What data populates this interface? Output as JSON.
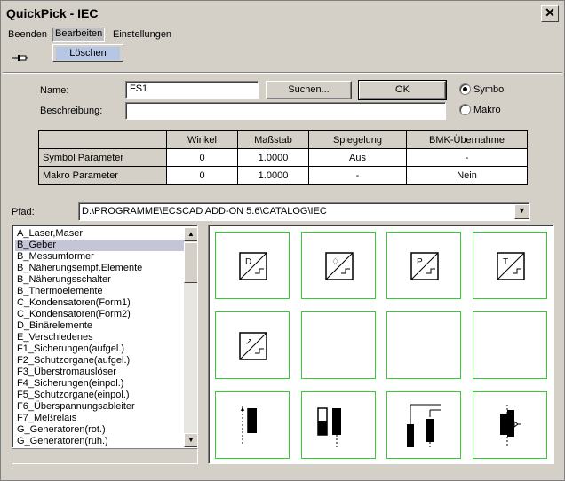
{
  "window": {
    "title": "QuickPick - IEC",
    "close_glyph": "✕"
  },
  "menu": {
    "items": [
      "Beenden",
      "Bearbeiten",
      "Einstellungen"
    ],
    "dropdown": {
      "item": "Löschen"
    }
  },
  "toolbar": {
    "pin_icon": "pin-icon"
  },
  "form": {
    "name_label": "Name:",
    "name_value": "FS1",
    "search_button": "Suchen...",
    "ok_button": "OK",
    "description_label": "Beschreibung:",
    "description_value": "",
    "radio_symbol": "Symbol",
    "radio_macro": "Makro",
    "selected_radio": "Symbol"
  },
  "params": {
    "headers": [
      "",
      "Winkel",
      "Maßstab",
      "Spiegelung",
      "BMK-Übernahme"
    ],
    "rows": [
      {
        "label": "Symbol Parameter",
        "values": [
          "0",
          "1.0000",
          "Aus",
          "-"
        ]
      },
      {
        "label": "Makro Parameter",
        "values": [
          "0",
          "1.0000",
          "-",
          "Nein"
        ]
      }
    ]
  },
  "path": {
    "label": "Pfad:",
    "value": "D:\\PROGRAMME\\ECSCAD ADD-ON 5.6\\CATALOG\\IEC"
  },
  "list": {
    "items": [
      "A_Laser,Maser",
      "B_Geber",
      "B_Messumformer",
      "B_Näherungsempf.Elemente",
      "B_Näherungsschalter",
      "B_Thermoelemente",
      "C_Kondensatoren(Form1)",
      "C_Kondensatoren(Form2)",
      "D_Binärelemente",
      "E_Verschiedenes",
      "F1_Sicherungen(aufgel.)",
      "F2_Schutzorgane(aufgel.)",
      "F3_Überstromauslöser",
      "F4_Sicherungen(einpol.)",
      "F5_Schutzorgane(einpol.)",
      "F6_Überspannungsableiter",
      "F7_Meßrelais",
      "G_Generatoren(rot.)",
      "G_Generatoren(ruh.)"
    ],
    "selected_index": 1
  },
  "symbols": {
    "cells": [
      {
        "kind": "sensor",
        "letter": "D"
      },
      {
        "kind": "sensor",
        "letter": "♢"
      },
      {
        "kind": "sensor",
        "letter": "P"
      },
      {
        "kind": "sensor",
        "letter": "T"
      },
      {
        "kind": "sensor",
        "letter": "↗"
      },
      {
        "kind": "empty",
        "letter": ""
      },
      {
        "kind": "empty",
        "letter": ""
      },
      {
        "kind": "empty",
        "letter": ""
      },
      {
        "kind": "cap1",
        "letter": ""
      },
      {
        "kind": "cap2",
        "letter": ""
      },
      {
        "kind": "cap3",
        "letter": ""
      },
      {
        "kind": "cap4",
        "letter": ""
      }
    ]
  },
  "colors": {
    "cell_border": "#33cc33",
    "selection": "#c5c5d8",
    "menu_highlight": "#b6c6e5"
  }
}
